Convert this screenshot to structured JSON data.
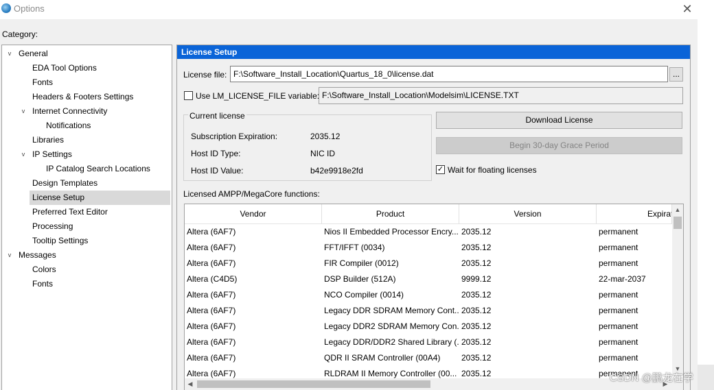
{
  "window": {
    "title": "Options",
    "close_glyph": "✕"
  },
  "category_label": "Category:",
  "tree": [
    {
      "label": "General",
      "expander": "expanded"
    },
    {
      "label": "EDA Tool Options"
    },
    {
      "label": "Fonts"
    },
    {
      "label": "Headers & Footers Settings"
    },
    {
      "label": "Internet Connectivity",
      "expander": "expanded"
    },
    {
      "label": "Notifications"
    },
    {
      "label": "Libraries"
    },
    {
      "label": "IP Settings",
      "expander": "expanded"
    },
    {
      "label": "IP Catalog Search Locations"
    },
    {
      "label": "Design Templates"
    },
    {
      "label": "License Setup",
      "selected": true
    },
    {
      "label": "Preferred Text Editor"
    },
    {
      "label": "Processing"
    },
    {
      "label": "Tooltip Settings"
    },
    {
      "label": "Messages",
      "expander": "expanded"
    },
    {
      "label": "Colors"
    },
    {
      "label": "Fonts"
    }
  ],
  "panel": {
    "title": "License Setup",
    "license_file_label": "License file:",
    "license_file_value": "F:\\Software_Install_Location\\Quartus_18_0\\license.dat",
    "browse_label": "...",
    "use_lm_label": "Use LM_LICENSE_FILE variable:",
    "use_lm_checked": false,
    "lm_value": "F:\\Software_Install_Location\\Modelsim\\LICENSE.TXT",
    "current_license": {
      "title": "Current license",
      "subscription_label": "Subscription Expiration:",
      "subscription_value": "2035.12",
      "host_type_label": "Host ID Type:",
      "host_type_value": "NIC ID",
      "host_value_label": "Host ID Value:",
      "host_value_value": "b42e9918e2fd"
    },
    "download_label": "Download License",
    "grace_label": "Begin 30-day Grace Period",
    "wait_label": "Wait for floating licenses",
    "wait_checked": true,
    "check_glyph": "✓",
    "licensed_label": "Licensed AMPP/MegaCore functions:"
  },
  "table": {
    "columns": [
      "Vendor",
      "Product",
      "Version",
      "Expirat"
    ],
    "rows": [
      [
        "Altera (6AF7)",
        "Nios II Embedded Processor Encry...",
        "2035.12",
        "permanent"
      ],
      [
        "Altera (6AF7)",
        "FFT/IFFT (0034)",
        "2035.12",
        "permanent"
      ],
      [
        "Altera (6AF7)",
        "FIR Compiler (0012)",
        "2035.12",
        "permanent"
      ],
      [
        "Altera (C4D5)",
        "DSP Builder (512A)",
        "9999.12",
        "22-mar-2037"
      ],
      [
        "Altera (6AF7)",
        "NCO Compiler (0014)",
        "2035.12",
        "permanent"
      ],
      [
        "Altera (6AF7)",
        "Legacy DDR SDRAM Memory Cont...",
        "2035.12",
        "permanent"
      ],
      [
        "Altera (6AF7)",
        "Legacy DDR2 SDRAM Memory Con...",
        "2035.12",
        "permanent"
      ],
      [
        "Altera (6AF7)",
        "Legacy DDR/DDR2 Shared Library (...",
        "2035.12",
        "permanent"
      ],
      [
        "Altera (6AF7)",
        "QDR II SRAM Controller (00A4)",
        "2035.12",
        "permanent"
      ],
      [
        "Altera (6AF7)",
        "RLDRAM II Memory Controller (00...",
        "2035.12",
        "permanent"
      ]
    ]
  },
  "scroll": {
    "up": "▲",
    "down": "▼",
    "left": "◀",
    "right": "▶"
  },
  "expander_glyph": "v",
  "watermark": "CSDN @鹏龙在学",
  "colors": {
    "header": "#0a64d8",
    "selection": "#d9d9d9"
  }
}
